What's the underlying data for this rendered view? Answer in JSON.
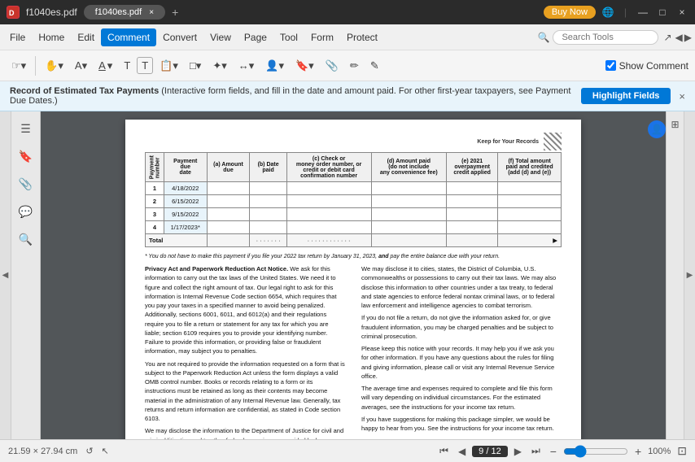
{
  "titlebar": {
    "icon": "DC",
    "filename": "f1040es.pdf",
    "tab_close": "×",
    "add_tab": "+",
    "buy_now": "Buy Now",
    "win_buttons": [
      "—",
      "□",
      "×"
    ]
  },
  "menubar": {
    "items": [
      "File",
      "Home",
      "Edit",
      "Comment",
      "Convert",
      "View",
      "Page",
      "Tool",
      "Form",
      "Protect"
    ],
    "active": "Comment",
    "search_placeholder": "Search Tools"
  },
  "toolbar": {
    "groups": [
      [
        "✎▾",
        "☁▾",
        "A▾",
        "T̲▾",
        "T",
        "T",
        "□▾",
        "✦▾",
        "⇄▾",
        "👤▾",
        "🔖▾",
        "📎",
        "🖊",
        "✎"
      ],
      [
        "↩",
        "↪"
      ]
    ],
    "show_comment": "Show Comment",
    "show_comment_checked": true
  },
  "notification": {
    "text": "Record of Estimated Tax Payments (Interactive form fields, and fill in the date and amount paid. For other first-year taxpayers, see Payment Due Dates.)",
    "highlight_btn": "Highlight Fields",
    "close": "×"
  },
  "table": {
    "caption": "Record of Estimated Tax Payments",
    "keep_records": "Keep for Your Records",
    "row_label": "Payment number",
    "headers": [
      "Payment due date",
      "(a) Amount due",
      "(b) Date paid",
      "(c) Check or money order number, or credit or debit card confirmation number",
      "(d) Amount paid (do not include any convenience fee)",
      "(e) 2021 overpayment credit applied",
      "(f) Total amount paid and credited (add (d) and (e))"
    ],
    "rows": [
      {
        "num": "1",
        "due": "4/18/2022",
        "a": "",
        "b": "",
        "c": "",
        "d": "",
        "e": "",
        "f": ""
      },
      {
        "num": "2",
        "due": "6/15/2022",
        "a": "",
        "b": "",
        "c": "",
        "d": "",
        "e": "",
        "f": ""
      },
      {
        "num": "3",
        "due": "9/15/2022",
        "a": "",
        "b": "",
        "c": "",
        "d": "",
        "e": "",
        "f": ""
      },
      {
        "num": "4",
        "due": "1/17/2023*",
        "a": "",
        "b": "",
        "c": "",
        "d": "",
        "e": "",
        "f": ""
      }
    ],
    "total_label": "Total",
    "footnote": "* You do not have to make this payment if you file your 2022 tax return by January 31, 2023, and pay the entire balance due with your return."
  },
  "content": {
    "section_title": "Privacy Act and Paperwork Reduction Act Notice.",
    "left_col": "We ask for this information to carry out the tax laws of the United States. We need it to figure and collect the right amount of tax. Our legal right to ask for this information is Internal Revenue Code section 6654, which requires that you pay your taxes in a specified manner to avoid being penalized. Additionally, sections 6001, 6011, and 6012(a) and their regulations require you to file a return or statement for any tax for which you are liable; section 6109 requires you to provide your identifying number. Failure to provide this information, or providing false or fraudulent information, may subject you to penalties.\n\nYou are not required to provide the information requested on a form that is subject to the Paperwork Reduction Act unless the form displays a valid OMB control number. Books or records relating to a form or its instructions must be retained as long as their contents may become material in the administration of any Internal Revenue law. Generally, tax returns and return information are confidential, as stated in Code section 6103.\n\nWe may disclose the information to the Department of Justice for civil and criminal litigation and to other federal agencies, as provided by law.",
    "right_col": "We may disclose it to cities, states, the District of Columbia, U.S. commonwealths or possessions to carry out their tax laws. We may also disclose this information to other countries under a tax treaty, to federal and state agencies to enforce federal nontax criminal laws, or to federal law enforcement and intelligence agencies to combat terrorism.\n\nIf you do not file a return, do not give the information asked for, or give fraudulent information, you may be charged penalties and be subject to criminal prosecution.\n\nPlease keep this notice with your records. It may help you if we ask you for other information. If you have any questions about the rules for filing and giving information, please call or visit any Internal Revenue Service office.\n\nThe average time and expenses required to complete and file this form will vary depending on individual circumstances. For the estimated averages, see the instructions for your income tax return.\n\nIf you have suggestions for making this package simpler, we would be happy to hear from you. See the instructions for your income tax return."
  },
  "statusbar": {
    "dimensions": "21.59 × 27.94 cm",
    "current_page": "9",
    "total_pages": "12",
    "page_display": "9 / 12",
    "zoom": "100%",
    "nav_buttons": [
      "⏮",
      "◀",
      "▶",
      "⏭"
    ]
  },
  "sidebar": {
    "icons": [
      "☰",
      "🔖",
      "🔍",
      "💬",
      "🔎"
    ]
  }
}
